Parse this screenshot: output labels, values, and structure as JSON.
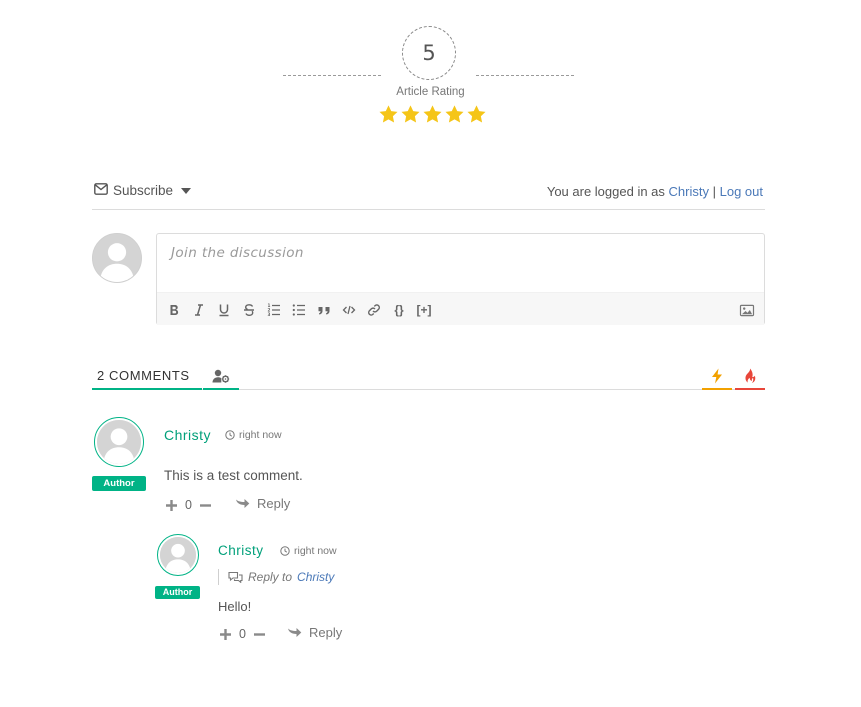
{
  "rating": {
    "value": "5",
    "label": "Article Rating",
    "stars": 5,
    "star_color": "#f5c518"
  },
  "subscribe_bar": {
    "subscribe_label": "Subscribe",
    "logged_in_prefix": "You are logged in as",
    "user": "Christy",
    "separator": "|",
    "logout_label": "Log out"
  },
  "editor": {
    "placeholder": "Join the discussion",
    "toolbar": [
      "bold",
      "italic",
      "underline",
      "strikethrough",
      "ordered-list",
      "unordered-list",
      "blockquote",
      "code",
      "link",
      "source-code",
      "spoiler",
      "image-upload"
    ],
    "source_code_label": "{}",
    "spoiler_label": "[+]"
  },
  "tabs": {
    "count_label": "2 COMMENTS",
    "accent": "#00b386",
    "hot_color": "#f2a100",
    "fire_color": "#e8463a"
  },
  "comments": [
    {
      "author": "Christy",
      "time": "right now",
      "badge": "Author",
      "text": "This is a test comment.",
      "votes": "0",
      "reply_label": "Reply"
    },
    {
      "author": "Christy",
      "time": "right now",
      "badge": "Author",
      "reply_to_prefix": "Reply to",
      "reply_to_name": "Christy",
      "text": "Hello!",
      "votes": "0",
      "reply_label": "Reply"
    }
  ]
}
